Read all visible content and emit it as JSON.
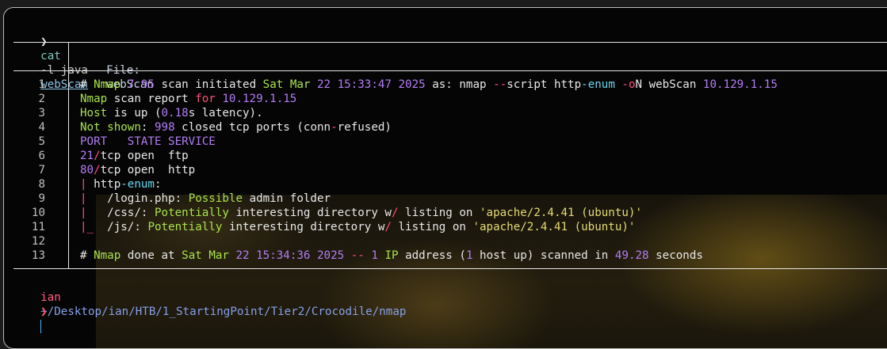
{
  "terminal": {
    "prompt_symbol": "❯",
    "command": {
      "program": "cat",
      "flags": "-l java",
      "file": "webScan"
    },
    "viewer_header": {
      "file_label": "File:",
      "file_name": "webScan"
    },
    "lines": [
      {
        "n": "1",
        "segs": [
          [
            "# ",
            "white"
          ],
          [
            "Nmap ",
            "green"
          ],
          [
            "7.95 ",
            "purple"
          ],
          [
            "scan initiated ",
            "white"
          ],
          [
            "Sat Mar ",
            "green"
          ],
          [
            "22 15:33:47 2025 ",
            "purple"
          ],
          [
            "as: nmap ",
            "white"
          ],
          [
            "--",
            "pink"
          ],
          [
            "script http",
            "white"
          ],
          [
            "-enum ",
            "cyan"
          ],
          [
            "-o",
            "pink"
          ],
          [
            "N webScan ",
            "white"
          ],
          [
            "10.129.1.15",
            "purple"
          ]
        ]
      },
      {
        "n": "2",
        "segs": [
          [
            "Nmap ",
            "green"
          ],
          [
            "scan report ",
            "white"
          ],
          [
            "for ",
            "pink"
          ],
          [
            "10.129.1.15",
            "purple"
          ]
        ]
      },
      {
        "n": "3",
        "segs": [
          [
            "Host ",
            "green"
          ],
          [
            "is up (",
            "white"
          ],
          [
            "0.18",
            "purple"
          ],
          [
            "s latency).",
            "white"
          ]
        ]
      },
      {
        "n": "4",
        "segs": [
          [
            "Not ",
            "green"
          ],
          [
            "shown",
            "green"
          ],
          [
            ": ",
            "white"
          ],
          [
            "998 ",
            "purple"
          ],
          [
            "closed tcp ports (conn",
            "white"
          ],
          [
            "-",
            "pink"
          ],
          [
            "refused)",
            "white"
          ]
        ]
      },
      {
        "n": "5",
        "segs": [
          [
            "PORT   STATE SERVICE",
            "purple"
          ]
        ]
      },
      {
        "n": "6",
        "segs": [
          [
            "21",
            "purple"
          ],
          [
            "/",
            "pink"
          ],
          [
            "tcp open  ftp",
            "white"
          ]
        ]
      },
      {
        "n": "7",
        "segs": [
          [
            "80",
            "purple"
          ],
          [
            "/",
            "pink"
          ],
          [
            "tcp open  http",
            "white"
          ]
        ]
      },
      {
        "n": "8",
        "segs": [
          [
            "| ",
            "pink"
          ],
          [
            "http",
            "white"
          ],
          [
            "-enum",
            "cyan"
          ],
          [
            ":",
            "white"
          ]
        ]
      },
      {
        "n": "9",
        "segs": [
          [
            "|   ",
            "pink"
          ],
          [
            "/login.php",
            "white"
          ],
          [
            ": ",
            "white"
          ],
          [
            "Possible ",
            "green"
          ],
          [
            "admin folder",
            "white"
          ]
        ]
      },
      {
        "n": "10",
        "segs": [
          [
            "|   ",
            "pink"
          ],
          [
            "/css/",
            "white"
          ],
          [
            ": ",
            "white"
          ],
          [
            "Potentially ",
            "green"
          ],
          [
            "interesting directory w",
            "white"
          ],
          [
            "/ ",
            "pink"
          ],
          [
            "listing on ",
            "white"
          ],
          [
            "'apache/2.4.41 (ubuntu)'",
            "yellow"
          ]
        ]
      },
      {
        "n": "11",
        "segs": [
          [
            "|_  ",
            "pink"
          ],
          [
            "/js/",
            "white"
          ],
          [
            ": ",
            "white"
          ],
          [
            "Potentially ",
            "green"
          ],
          [
            "interesting directory w",
            "white"
          ],
          [
            "/ ",
            "pink"
          ],
          [
            "listing on ",
            "white"
          ],
          [
            "'apache/2.4.41 (ubuntu)'",
            "yellow"
          ]
        ]
      },
      {
        "n": "12",
        "segs": []
      },
      {
        "n": "13",
        "segs": [
          [
            "# ",
            "white"
          ],
          [
            "Nmap ",
            "green"
          ],
          [
            "done at ",
            "white"
          ],
          [
            "Sat Mar ",
            "green"
          ],
          [
            "22 15:34:36 2025 ",
            "purple"
          ],
          [
            "-- ",
            "pink"
          ],
          [
            "1 ",
            "purple"
          ],
          [
            "IP ",
            "green"
          ],
          [
            "address (",
            "white"
          ],
          [
            "1 ",
            "purple"
          ],
          [
            "host up) scanned in ",
            "white"
          ],
          [
            "49.28 ",
            "purple"
          ],
          [
            "seconds",
            "white"
          ]
        ]
      }
    ],
    "path": {
      "user": "ian",
      "dir": "~/Desktop/ian/HTB/1_StartingPoint/Tier2/Crocodile/nmap"
    }
  },
  "colors": {
    "green": "#a9e34b",
    "purple": "#b27cf5",
    "pink": "#ff4f7b",
    "cyan": "#66d9ef",
    "yellow": "#e6db74",
    "white": "#e8e8e8"
  }
}
